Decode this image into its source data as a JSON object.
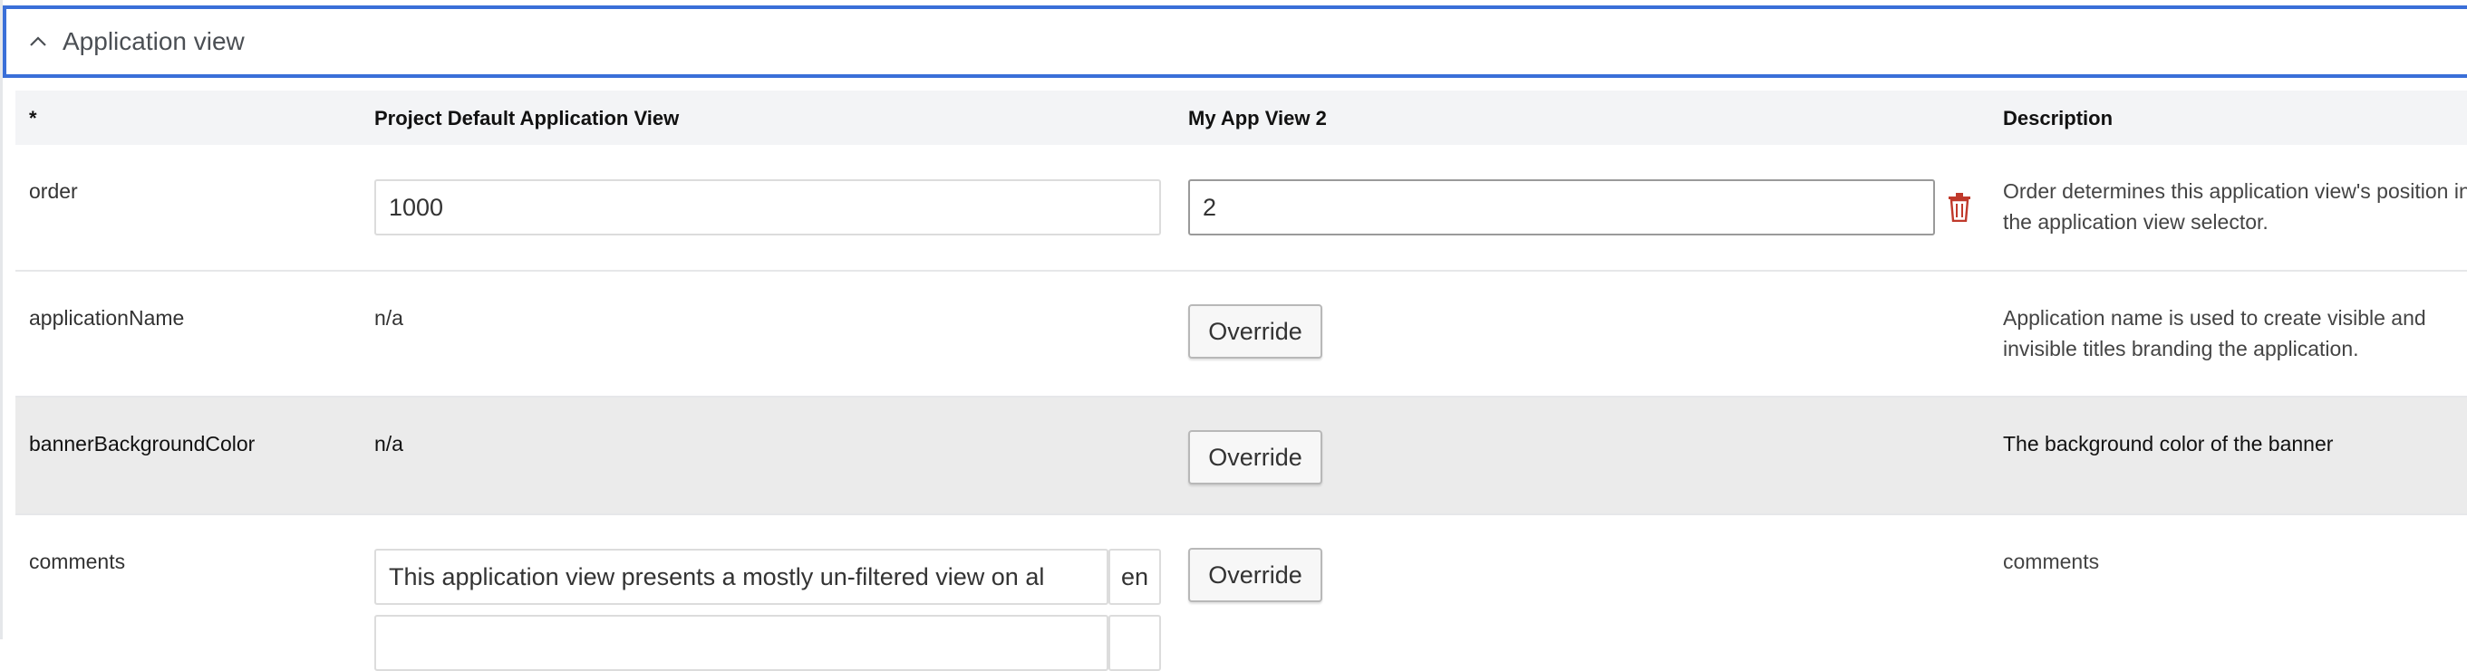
{
  "panel": {
    "title": "Application view"
  },
  "columns": {
    "key": "*",
    "default_view": "Project Default Application View",
    "my_view": "My App View 2",
    "description": "Description"
  },
  "rows": {
    "order": {
      "label": "order",
      "default_value": "1000",
      "my_value": "2",
      "description": "Order determines this application view's position in the application view selector."
    },
    "applicationName": {
      "label": "applicationName",
      "default_value": "n/a",
      "my_action": "Override",
      "description": "Application name is used to create visible and invisible titles branding the application."
    },
    "bannerBackgroundColor": {
      "label": "bannerBackgroundColor",
      "default_value": "n/a",
      "my_action": "Override",
      "description": "The background color of the banner"
    },
    "comments": {
      "label": "comments",
      "default_value": "This application view presents a mostly un-filtered view on al",
      "default_lang": "en",
      "second_value": "",
      "second_lang": "",
      "my_action": "Override",
      "description": "comments"
    }
  },
  "colors": {
    "accent_border": "#3a6fd8",
    "header_bg": "#f3f4f6",
    "shaded_row": "#ebebeb",
    "delete_icon": "#c0392b"
  },
  "icons": {
    "collapse": "chevron-up-icon",
    "delete": "trash-icon"
  }
}
